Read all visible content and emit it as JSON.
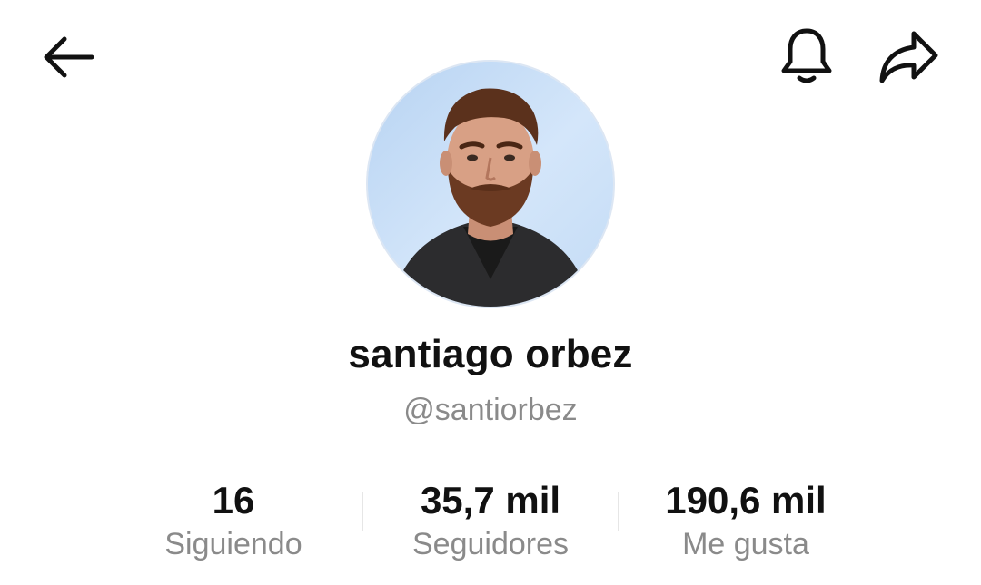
{
  "header": {
    "back_icon": "arrow-left-icon",
    "notifications_icon": "bell-icon",
    "share_icon": "share-arrow-icon"
  },
  "profile": {
    "display_name": "santiago orbez",
    "username": "@santiorbez",
    "avatar": "profile-photo"
  },
  "stats": [
    {
      "value": "16",
      "label": "Siguiendo"
    },
    {
      "value": "35,7 mil",
      "label": "Seguidores"
    },
    {
      "value": "190,6 mil",
      "label": "Me gusta"
    }
  ],
  "colors": {
    "text_primary": "#111111",
    "text_secondary": "#8a8a8a",
    "background": "#ffffff",
    "divider": "#e6e6e6"
  }
}
